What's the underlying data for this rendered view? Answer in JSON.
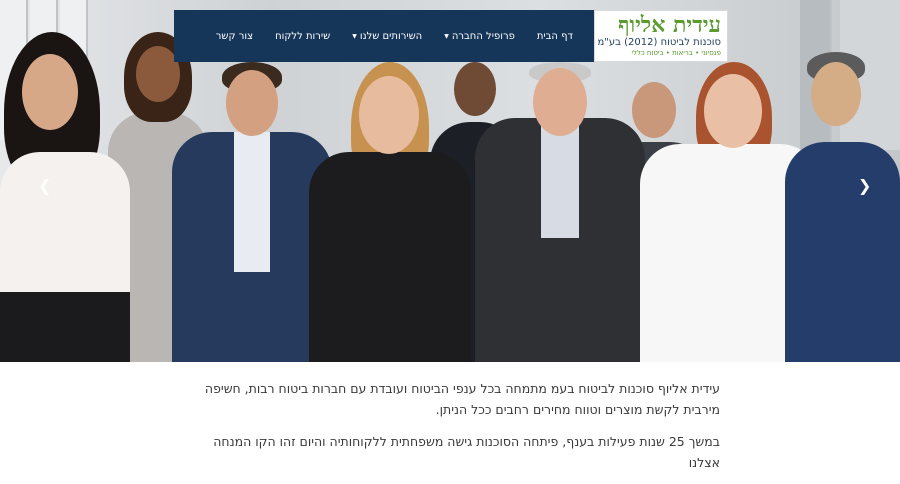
{
  "brand": {
    "name": "עידית אליוף",
    "subtitle": "סוכנות לביטוח (2012) בע\"מ",
    "tagline": "פנסיוני • בריאות • ביטוח כללי",
    "primary_color": "#163659",
    "accent_color": "#5a9a2f"
  },
  "nav": {
    "items": [
      {
        "label": "דף הבית",
        "has_dropdown": false
      },
      {
        "label": "פרופיל החברה",
        "has_dropdown": true
      },
      {
        "label": "השירותים שלנו",
        "has_dropdown": true
      },
      {
        "label": "שירות ללקוח",
        "has_dropdown": false
      },
      {
        "label": "צור קשר",
        "has_dropdown": false
      }
    ]
  },
  "slider": {
    "prev_icon": "chevron-left-icon",
    "next_icon": "chevron-right-icon"
  },
  "content": {
    "paragraph1": "עידית אליוף סוכנות לביטוח בעמ מתמחה בכל ענפי הביטוח ועובדת עם חברות ביטוח רבות, חשיפה מירבית לקשת מוצרים וטווח מחירים רחבים ככל הניתן.",
    "paragraph2": "במשך 25 שנות פעילות בענף, פיתחה הסוכנות גישה משפחתית ללקוחותיה והיום זהו הקו המנחה אצלנו"
  }
}
